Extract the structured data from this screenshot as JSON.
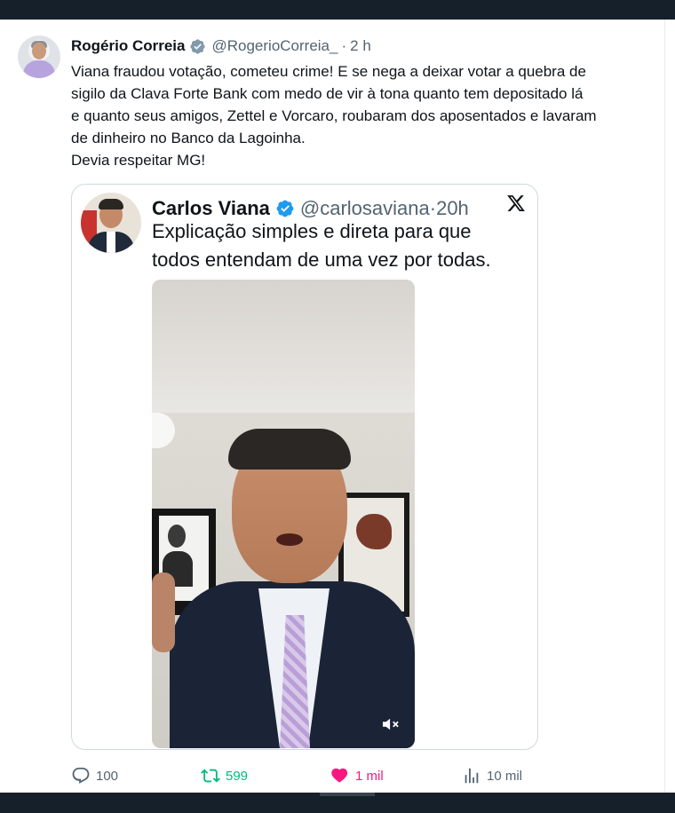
{
  "tweet": {
    "author": "Rogério Correia",
    "handle": "@RogerioCorreia_",
    "separator": "·",
    "time": "2 h",
    "text_lines": [
      "Viana fraudou votação, cometeu crime! E se nega a deixar votar a quebra de",
      "sigilo da Clava Forte Bank com medo de vir à tona quanto tem depositado lá",
      "e quanto seus amigos, Zettel e Vorcaro, roubaram dos aposentados e lavaram",
      "de dinheiro no Banco da Lagoinha.",
      "Devia respeitar MG!"
    ]
  },
  "quoted": {
    "author": "Carlos Viana",
    "handle": "@carlosaviana",
    "separator": "·",
    "time": "20h",
    "text_lines": [
      "Explicação simples e direta para que",
      "todos entendam de uma vez por todas."
    ],
    "video_muted": true
  },
  "actions": {
    "replies": "100",
    "retweets": "599",
    "likes": "1 mil",
    "views": "10 mil"
  },
  "colors": {
    "verified": "#1d9bf0",
    "retweet": "#00ba7c",
    "like": "#f91880",
    "muted_text": "#536471",
    "chrome": "#15202b"
  },
  "icons": [
    "verified-badge-icon",
    "x-logo-icon",
    "mute-icon",
    "reply-icon",
    "retweet-icon",
    "like-icon",
    "views-icon"
  ]
}
